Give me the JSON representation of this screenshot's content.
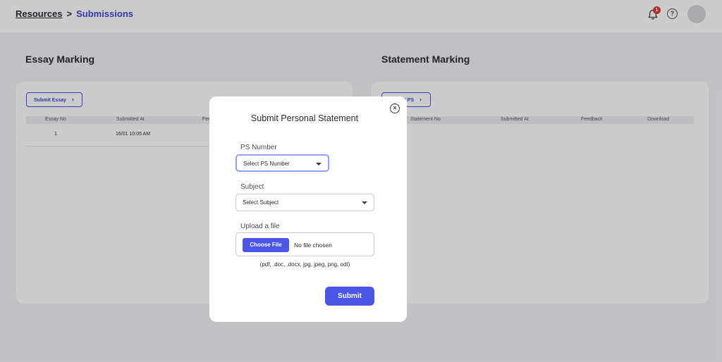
{
  "breadcrumb": {
    "parent": "Resources",
    "separator": ">",
    "current": "Submissions"
  },
  "header": {
    "notification_count": "1",
    "help_glyph": "?"
  },
  "essay": {
    "title": "Essay Marking",
    "button_label": "Submit Essay",
    "columns": [
      "Essay No",
      "Submitted At",
      "Feedback"
    ],
    "rows": [
      {
        "no": "1",
        "submitted_at": "16/01 10:05 AM"
      }
    ]
  },
  "statement": {
    "title": "Statement Marking",
    "button_label": "Submit PS",
    "columns": [
      "Statement No",
      "Submitted At",
      "Feedback",
      "Download"
    ]
  },
  "modal": {
    "title": "Submit Personal Statement",
    "close_glyph": "×",
    "ps_label": "PS Number",
    "ps_placeholder": "Select PS Number",
    "subject_label": "Subject",
    "subject_placeholder": "Select Subject",
    "upload_label": "Upload a file",
    "choose_file": "Choose File",
    "no_file": "No file chosen",
    "formats": "(pdf, .doc, .docx, jpg, jpeg, png, odt)",
    "submit": "Submit"
  },
  "colors": {
    "accent": "#4b55e6",
    "badge": "#e23b3b",
    "overlay": "rgba(0,0,0,0.2)"
  },
  "icons": [
    "bell-icon",
    "help-icon",
    "chevron-right-icon",
    "close-icon",
    "caret-down-icon"
  ]
}
